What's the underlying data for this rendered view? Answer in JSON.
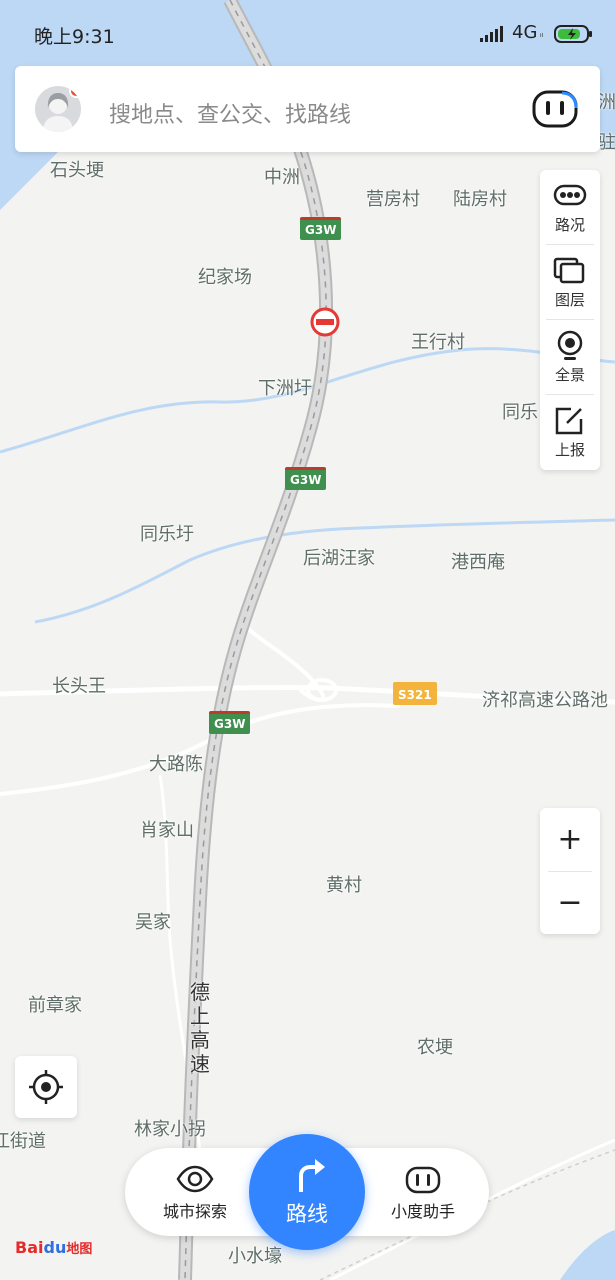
{
  "status_bar": {
    "time": "晚上9:31",
    "network": "4G",
    "network_sub": "ᵢₗ"
  },
  "search": {
    "placeholder": "搜地点、查公交、找路线"
  },
  "tools": [
    {
      "id": "traffic",
      "label": "路况",
      "icon": "traffic-icon"
    },
    {
      "id": "layers",
      "label": "图层",
      "icon": "layers-icon"
    },
    {
      "id": "panorama",
      "label": "全景",
      "icon": "panorama-icon"
    },
    {
      "id": "report",
      "label": "上报",
      "icon": "report-icon"
    }
  ],
  "zoom": {
    "in": "+",
    "out": "−"
  },
  "bottom_bar": {
    "explore": "城市探索",
    "route": "路线",
    "assistant": "小度助手"
  },
  "logo": {
    "bai": "Bai",
    "du": "du",
    "map": "地图"
  },
  "map": {
    "places": [
      "石头埂",
      "中洲",
      "营房村",
      "陆房村",
      "纪家场",
      "王行村",
      "下洲圩",
      "同乐",
      "同乐圩",
      "后湖汪家",
      "港西庵",
      "长头王",
      "济祁高速公路池",
      "大路陈",
      "肖家山",
      "黄村",
      "吴家",
      "前章家",
      "农埂",
      "林家小拐",
      "江街道",
      "小水壕",
      "洲",
      "驻"
    ],
    "highway_label": "德上高速",
    "shields": [
      "G3W",
      "G3W",
      "G3W",
      "S321"
    ]
  }
}
